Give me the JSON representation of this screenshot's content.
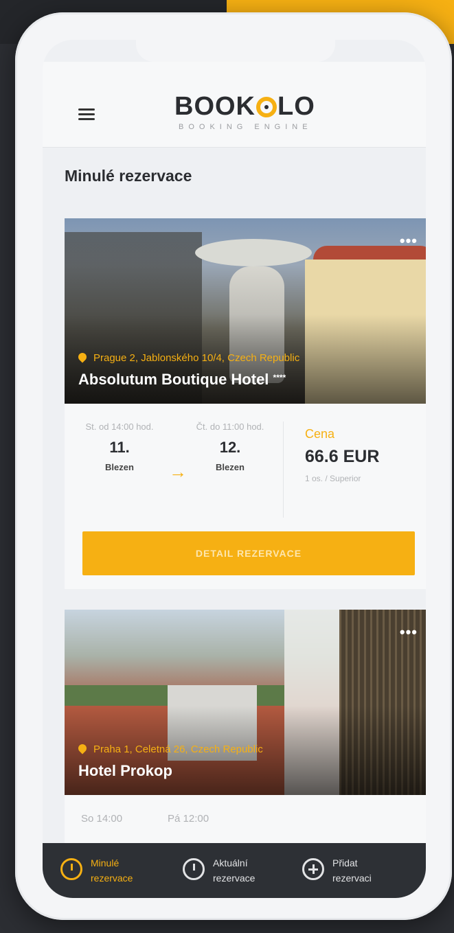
{
  "header": {
    "brand": "BOOK",
    "brand_tail": "LO",
    "brand_sub": "BOOKING ENGINE"
  },
  "page_title": "Minulé rezervace",
  "reservations": [
    {
      "address": "Prague 2, Jablonského 10/4, Czech Republic",
      "hotel_name": "Absolutum Boutique Hotel",
      "stars": "****",
      "checkin_time": "St. od 14:00 hod.",
      "checkin_day": "11.",
      "checkin_month": "Blezen",
      "checkout_time": "Čt. do 11:00 hod.",
      "checkout_day": "12.",
      "checkout_month": "Blezen",
      "price_label": "Cena",
      "price": "66.6 EUR",
      "room": "1 os. / Superior",
      "button_label": "DETAIL REZERVACE"
    },
    {
      "address": "Praha 1, Celetná 26, Czech Republic",
      "hotel_name": "Hotel Prokop",
      "checkin_time": "So 14:00",
      "checkout_time": "Pá 12:00"
    }
  ],
  "tabbar": {
    "tabs": [
      {
        "line1": "Minulé",
        "line2": "rezervace",
        "icon": "history-clock-icon",
        "active": true
      },
      {
        "line1": "Aktuální",
        "line2": "rezervace",
        "icon": "clock-icon",
        "active": false
      },
      {
        "line1": "Přidat",
        "line2": "rezervaci",
        "icon": "plus-circle-icon",
        "active": false
      }
    ]
  },
  "colors": {
    "accent": "#f6b013",
    "dark": "#2d3035",
    "text": "#2b2d31"
  }
}
